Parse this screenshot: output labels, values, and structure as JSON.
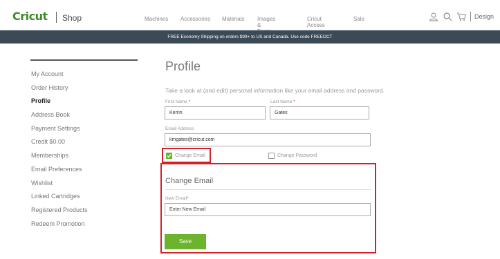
{
  "header": {
    "logo": "Cricut",
    "shop_label": "Shop",
    "nav": [
      "Machines",
      "Accessories",
      "Materials",
      "Images & Fonts",
      "Cricut Access",
      "Sale"
    ],
    "design_label": "Design",
    "icons": [
      "user-icon",
      "search-icon",
      "cart-icon"
    ]
  },
  "banner": {
    "text": "FREE Economy Shipping on orders $99+ to US and Canada. Use code FREEOCT"
  },
  "sidebar": {
    "items": [
      {
        "label": "My Account"
      },
      {
        "label": "Order History"
      },
      {
        "label": "Profile",
        "active": true
      },
      {
        "label": "Address Book"
      },
      {
        "label": "Payment Settings"
      },
      {
        "label": "Credit $0.00"
      },
      {
        "label": "Memberships"
      },
      {
        "label": "Email Preferences"
      },
      {
        "label": "Wishlist"
      },
      {
        "label": "Linked Cartridges"
      },
      {
        "label": "Registered Products"
      },
      {
        "label": "Redeem Promotion"
      }
    ]
  },
  "main": {
    "title": "Profile",
    "subtitle": "Take a look at (and edit) personal information like your email address and password.",
    "first_name": {
      "label": "First Name",
      "value": "Kerrin"
    },
    "last_name": {
      "label": "Last Name",
      "value": "Gates"
    },
    "email": {
      "label": "Email Address",
      "value": "kmgates@cricut.com"
    },
    "change_email": {
      "label": "Change Email",
      "checked": true
    },
    "change_password": {
      "label": "Change Password",
      "checked": false
    },
    "required_mark": "*",
    "change_email_section": {
      "title": "Change Email",
      "new_email_label": "New Email",
      "new_email_placeholder": "Enter New Email",
      "save_label": "Save"
    }
  },
  "colors": {
    "brand_green": "#6cb32e",
    "banner_bg": "#3c4a55",
    "highlight_red": "#d42127"
  }
}
